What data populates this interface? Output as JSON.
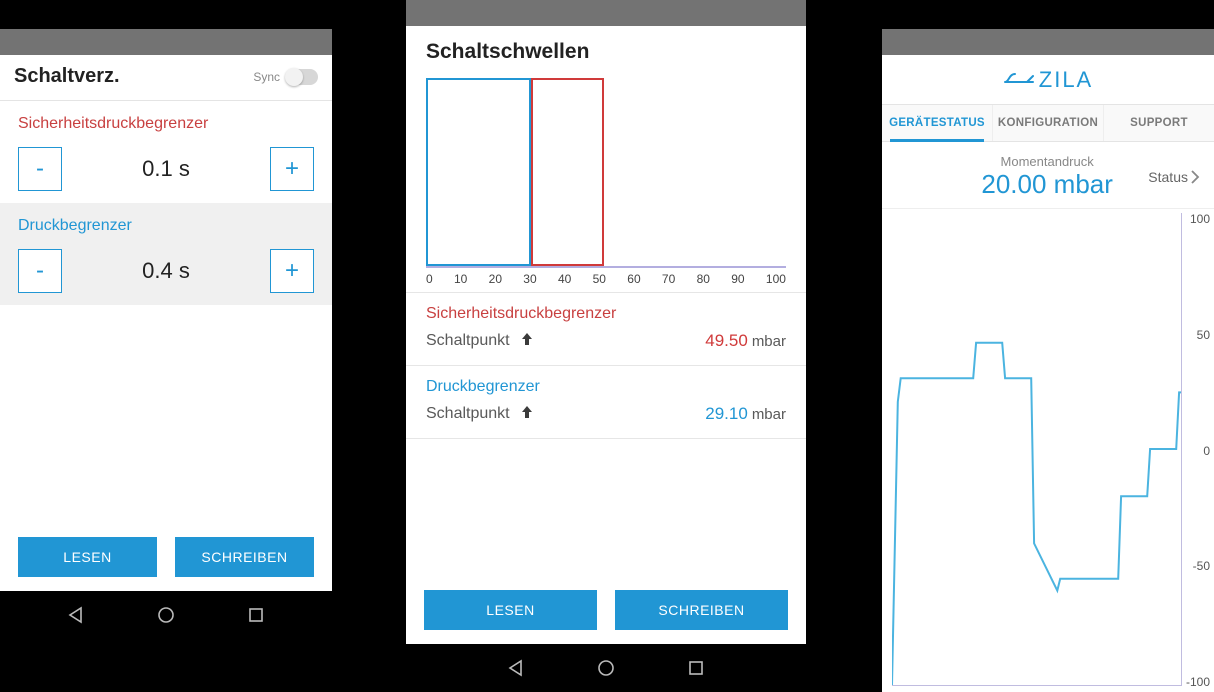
{
  "screen1": {
    "title": "Schaltverz.",
    "sync_label": "Sync",
    "block1": {
      "title": "Sicherheitsdruckbegrenzer",
      "value": "0.1 s"
    },
    "block2": {
      "title": "Druckbegrenzer",
      "value": "0.4 s"
    },
    "minus": "-",
    "plus": "+",
    "read_btn": "LESEN",
    "write_btn": "SCHREIBEN"
  },
  "screen2": {
    "title": "Schaltschwellen",
    "row1": {
      "title": "Sicherheitsdruckbegrenzer",
      "label": "Schaltpunkt",
      "value": "49.50",
      "unit": "mbar"
    },
    "row2": {
      "title": "Druckbegrenzer",
      "label": "Schaltpunkt",
      "value": "29.10",
      "unit": "mbar"
    },
    "read_btn": "LESEN",
    "write_btn": "SCHREIBEN",
    "xaxis": [
      "0",
      "10",
      "20",
      "30",
      "40",
      "50",
      "60",
      "70",
      "80",
      "90",
      "100"
    ]
  },
  "screen3": {
    "brand": "ZILA",
    "tabs": [
      "GERÄTESTATUS",
      "KONFIGURATION",
      "SUPPORT"
    ],
    "active_tab": 0,
    "reading_label": "Momentandruck",
    "reading_value": "20.00 mbar",
    "status_label": "Status",
    "yticks": [
      "100",
      "50",
      "0",
      "-50",
      "-100"
    ]
  },
  "chart_data": [
    {
      "type": "bar",
      "title": "Schaltschwellen",
      "xlim": [
        0,
        100
      ],
      "series": [
        {
          "name": "Druckbegrenzer",
          "range": [
            0,
            29.1
          ],
          "color": "#2196d4"
        },
        {
          "name": "Sicherheitsdruckbegrenzer",
          "range": [
            29.1,
            49.5
          ],
          "color": "#d03a3a"
        }
      ]
    },
    {
      "type": "line",
      "title": "Momentandruck",
      "ylabel": "mbar",
      "ylim": [
        -100,
        100
      ],
      "series": [
        {
          "name": "Druck",
          "x": [
            0,
            2,
            3,
            28,
            29,
            38,
            39,
            48,
            49,
            57,
            58,
            78,
            79,
            88,
            89,
            98,
            99,
            100
          ],
          "y": [
            -100,
            20,
            30,
            30,
            45,
            45,
            30,
            30,
            -40,
            -60,
            -55,
            -55,
            -20,
            -20,
            0,
            0,
            24,
            24
          ]
        }
      ]
    }
  ]
}
